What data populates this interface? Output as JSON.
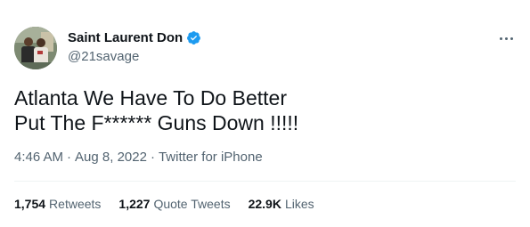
{
  "author": {
    "display_name": "Saint Laurent Don",
    "handle": "@21savage",
    "verified_badge_icon": "verified-check-icon",
    "verified_color": "#1d9bf0"
  },
  "menu": {
    "more_icon": "more-horizontal-icon"
  },
  "tweet": {
    "text": "Atlanta We Have To Do Better\nPut The F****** Guns Down !!!!!",
    "time": "4:46 AM",
    "separator1": "·",
    "date": "Aug 8, 2022",
    "separator2": "·",
    "source": "Twitter for iPhone"
  },
  "stats": [
    {
      "count": "1,754",
      "label": "Retweets"
    },
    {
      "count": "1,227",
      "label": "Quote Tweets"
    },
    {
      "count": "22.9K",
      "label": "Likes"
    }
  ],
  "colors": {
    "text_primary": "#0f1419",
    "text_secondary": "#536471",
    "divider": "#eff3f4",
    "background": "#ffffff"
  }
}
